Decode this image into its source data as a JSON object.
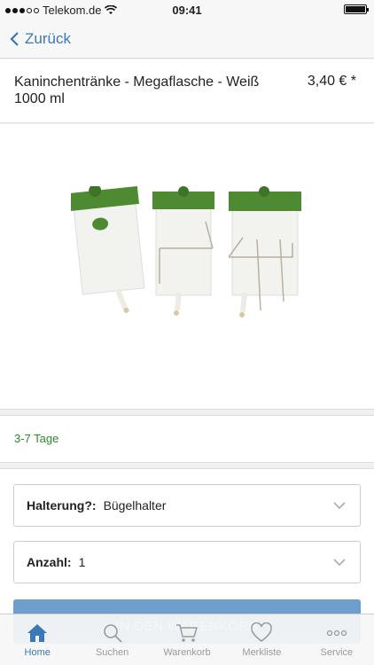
{
  "statusbar": {
    "carrier": "Telekom.de",
    "time": "09:41"
  },
  "nav": {
    "back_label": "Zurück"
  },
  "product": {
    "title": "Kaninchentränke - Megaflasche - Weiß 1000 ml",
    "price": "3,40 € *"
  },
  "delivery": {
    "text": "3-7 Tage"
  },
  "options": {
    "halterung": {
      "label": "Halterung?:",
      "value": "Bügelhalter"
    },
    "anzahl": {
      "label": "Anzahl:",
      "value": "1"
    }
  },
  "cart_button": {
    "label": "IN DEN WARENKORB"
  },
  "tabs": [
    {
      "label": "Home",
      "icon": "home-icon",
      "active": true
    },
    {
      "label": "Suchen",
      "icon": "search-icon",
      "active": false
    },
    {
      "label": "Warenkorb",
      "icon": "cart-icon",
      "active": false
    },
    {
      "label": "Merkliste",
      "icon": "heart-icon",
      "active": false
    },
    {
      "label": "Service",
      "icon": "more-icon",
      "active": false
    }
  ],
  "colors": {
    "accent": "#3a78b8",
    "delivery_green": "#2a8a2a",
    "bottle_green": "#4e8a32"
  }
}
